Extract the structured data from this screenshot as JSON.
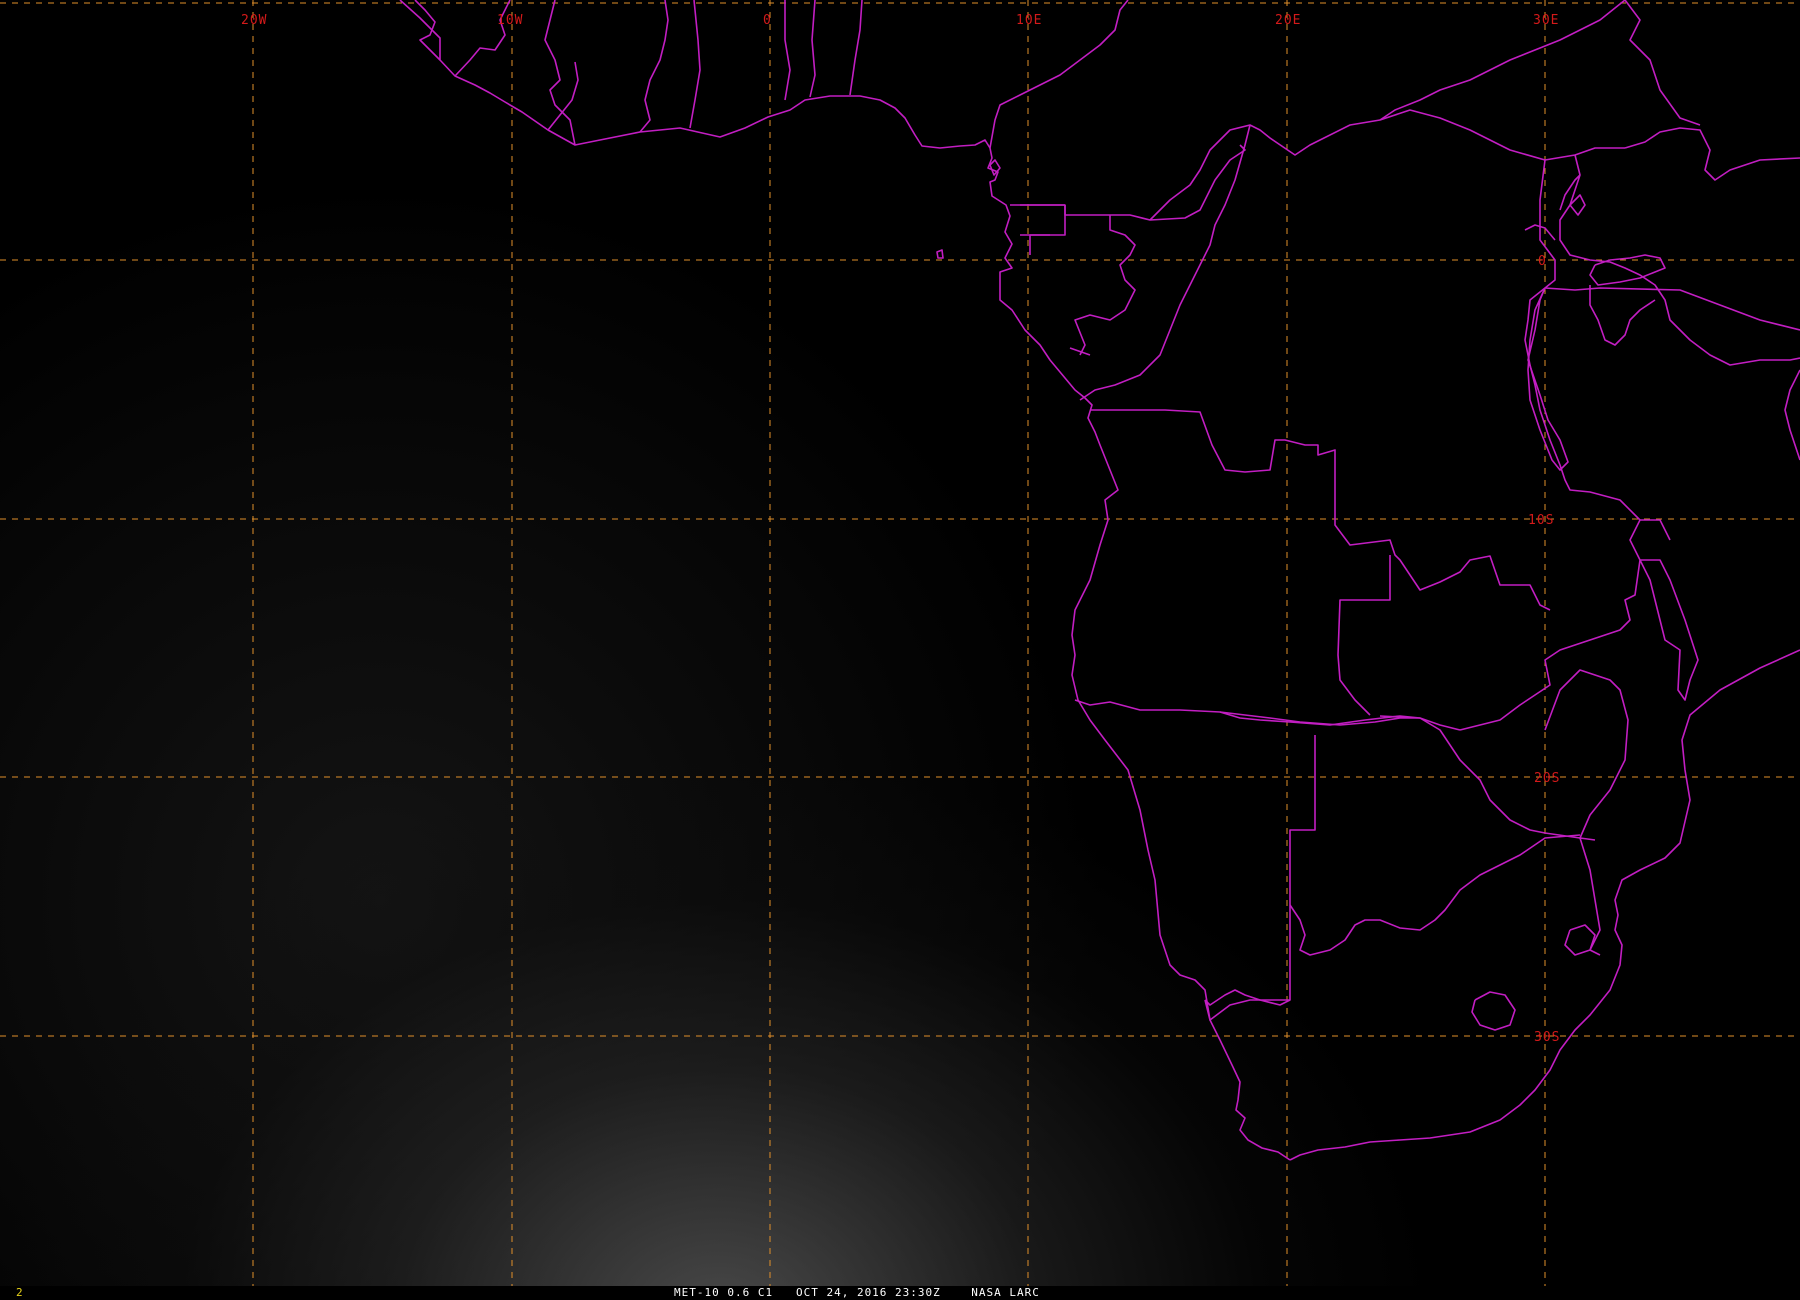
{
  "map": {
    "lon_labels": [
      "20W",
      "10W",
      "0",
      "10E",
      "20E",
      "30E"
    ],
    "lat_labels": [
      "0",
      "10S",
      "20S",
      "30S"
    ],
    "colors": {
      "grid": "#e08f2a",
      "borders": "#c21ec2",
      "labels": "#d41a1a",
      "frame_number": "#e6d21a"
    }
  },
  "status": {
    "frame_number": "2",
    "caption": "MET-10 0.6 C1   OCT 24, 2016 23:30Z    NASA LARC"
  }
}
